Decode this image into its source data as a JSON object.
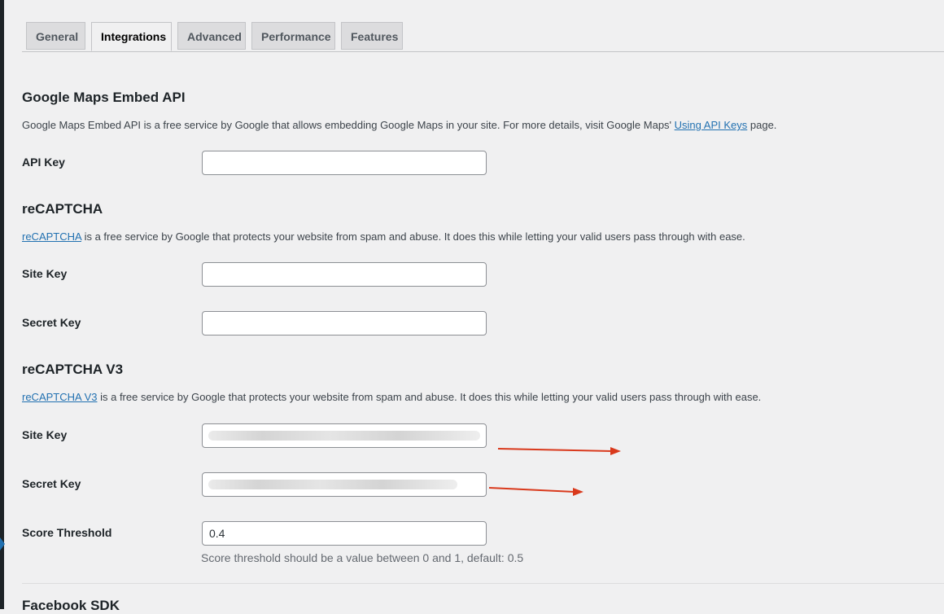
{
  "tabs": [
    {
      "label": "General",
      "active": false
    },
    {
      "label": "Integrations",
      "active": true
    },
    {
      "label": "Advanced",
      "active": false
    },
    {
      "label": "Performance",
      "active": false
    },
    {
      "label": "Features",
      "active": false
    }
  ],
  "maps": {
    "title": "Google Maps Embed API",
    "desc_before": "Google Maps Embed API is a free service by Google that allows embedding Google Maps in your site. For more details, visit Google Maps' ",
    "desc_link": "Using API Keys",
    "desc_after": " page.",
    "api_key_label": "API Key",
    "api_key_value": ""
  },
  "recaptcha": {
    "title": "reCAPTCHA",
    "desc_link": "reCAPTCHA",
    "desc_after": " is a free service by Google that protects your website from spam and abuse. It does this while letting your valid users pass through with ease.",
    "site_key_label": "Site Key",
    "site_key_value": "",
    "secret_key_label": "Secret Key",
    "secret_key_value": ""
  },
  "recaptcha_v3": {
    "title": "reCAPTCHA V3",
    "desc_link": "reCAPTCHA V3",
    "desc_after": " is a free service by Google that protects your website from spam and abuse. It does this while letting your valid users pass through with ease.",
    "site_key_label": "Site Key",
    "secret_key_label": "Secret Key",
    "score_label": "Score Threshold",
    "score_value": "0.4",
    "score_hint": "Score threshold should be a value between 0 and 1, default: 0.5"
  },
  "next_section": {
    "title": "Facebook SDK"
  },
  "colors": {
    "accent": "#2271b1",
    "annotation_arrow": "#d9391c"
  }
}
